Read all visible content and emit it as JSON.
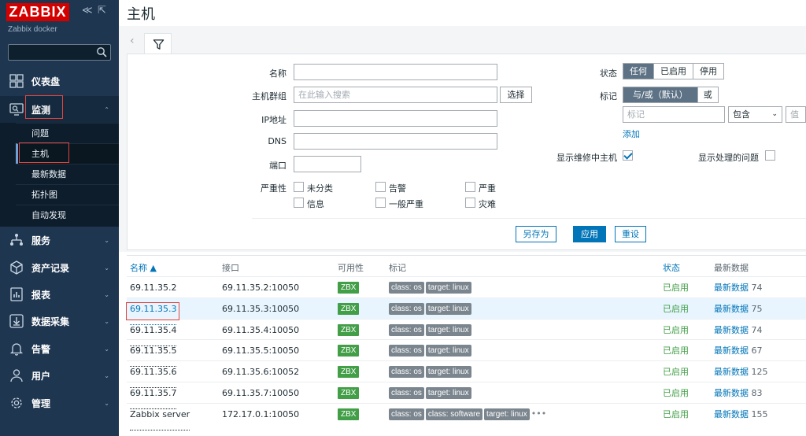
{
  "sidebar": {
    "logo": "ZABBIX",
    "server_name": "Zabbix docker",
    "collapse_glyph": "≪",
    "kiosk_glyph": "⇱",
    "search_placeholder": "",
    "items": [
      {
        "label": "仪表盘",
        "icon": "dashboard-icon"
      },
      {
        "label": "监测",
        "icon": "monitoring-icon"
      },
      {
        "label": "服务",
        "icon": "services-icon"
      },
      {
        "label": "资产记录",
        "icon": "inventory-icon"
      },
      {
        "label": "报表",
        "icon": "reports-icon"
      },
      {
        "label": "数据采集",
        "icon": "data-collection-icon"
      },
      {
        "label": "告警",
        "icon": "alerts-icon"
      },
      {
        "label": "用户",
        "icon": "users-icon"
      },
      {
        "label": "管理",
        "icon": "administration-icon"
      }
    ],
    "submenu": [
      "问题",
      "主机",
      "最新数据",
      "拓扑图",
      "自动发现"
    ],
    "chevron": "⌄",
    "chevron_up": "⌃"
  },
  "page": {
    "title": "主机"
  },
  "filter": {
    "name_label": "名称",
    "name_value": "",
    "hostgroup_label": "主机群组",
    "hostgroup_placeholder": "在此输入搜索",
    "select_button": "选择",
    "ip_label": "IP地址",
    "dns_label": "DNS",
    "port_label": "端口",
    "severity_label": "严重性",
    "severities": [
      "未分类",
      "告警",
      "严重",
      "信息",
      "一般严重",
      "灾难"
    ],
    "status_label": "状态",
    "status_options": [
      "任何",
      "已启用",
      "停用"
    ],
    "tags_label": "标记",
    "tag_ops": [
      "与/或（默认）",
      "或"
    ],
    "tag_placeholder": "标记",
    "tag_operator": "包含",
    "tag_value_placeholder": "值",
    "add_link": "添加",
    "maintenance_label": "显示维修中主机",
    "suppressed_label": "显示处理的问题",
    "save_as": "另存为",
    "apply": "应用",
    "reset": "重设"
  },
  "table": {
    "headers": {
      "name": "名称 ▲",
      "interface": "接口",
      "availability": "可用性",
      "tags": "标记",
      "status": "状态",
      "latest": "最新数据"
    },
    "rows": [
      {
        "name": "69.11.35.2",
        "interface": "69.11.35.2:10050",
        "avail": "ZBX",
        "tags": [
          "class: os",
          "target: linux"
        ],
        "status": "已启用",
        "latest": "最新数据",
        "count": "74"
      },
      {
        "name": "69.11.35.3",
        "interface": "69.11.35.3:10050",
        "avail": "ZBX",
        "tags": [
          "class: os",
          "target: linux"
        ],
        "status": "已启用",
        "latest": "最新数据",
        "count": "75"
      },
      {
        "name": "69.11.35.4",
        "interface": "69.11.35.4:10050",
        "avail": "ZBX",
        "tags": [
          "class: os",
          "target: linux"
        ],
        "status": "已启用",
        "latest": "最新数据",
        "count": "74"
      },
      {
        "name": "69.11.35.5",
        "interface": "69.11.35.5:10050",
        "avail": "ZBX",
        "tags": [
          "class: os",
          "target: linux"
        ],
        "status": "已启用",
        "latest": "最新数据",
        "count": "67"
      },
      {
        "name": "69.11.35.6",
        "interface": "69.11.35.6:10052",
        "avail": "ZBX",
        "tags": [
          "class: os",
          "target: linux"
        ],
        "status": "已启用",
        "latest": "最新数据",
        "count": "125"
      },
      {
        "name": "69.11.35.7",
        "interface": "69.11.35.7:10050",
        "avail": "ZBX",
        "tags": [
          "class: os",
          "target: linux"
        ],
        "status": "已启用",
        "latest": "最新数据",
        "count": "83"
      },
      {
        "name": "Zabbix server",
        "interface": "172.17.0.1:10050",
        "avail": "ZBX",
        "tags": [
          "class: os",
          "class: software",
          "target: linux"
        ],
        "status": "已启用",
        "latest": "最新数据",
        "count": "155",
        "more": "•••"
      }
    ]
  },
  "colors": {
    "sidebar": "#1f3650",
    "accent": "#0275b8",
    "ok": "#429e47",
    "highlight": "#e0443c"
  }
}
